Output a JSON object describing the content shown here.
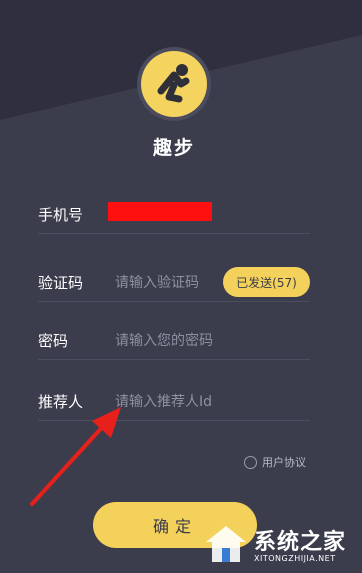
{
  "app": {
    "name": "趣步"
  },
  "form": {
    "phone": {
      "label": "手机号"
    },
    "code": {
      "label": "验证码",
      "placeholder": "请输入验证码",
      "send_button": "已发送(57)"
    },
    "password": {
      "label": "密码",
      "placeholder": "请输入您的密码"
    },
    "referrer": {
      "label": "推荐人",
      "placeholder": "请输入推荐人Id"
    }
  },
  "agreement": {
    "label": "用户协议",
    "checked": false
  },
  "confirm": {
    "label": "确定"
  },
  "watermark": {
    "main": "系统之家",
    "sub": "XITONGZHIJIA.NET"
  },
  "colors": {
    "background": "#3a3c4c",
    "accent": "#f3d15a",
    "annotation_arrow": "#e8201c",
    "redaction": "#ff1010"
  },
  "icons": {
    "logo": "running-person-icon",
    "watermark_logo": "house-icon"
  }
}
